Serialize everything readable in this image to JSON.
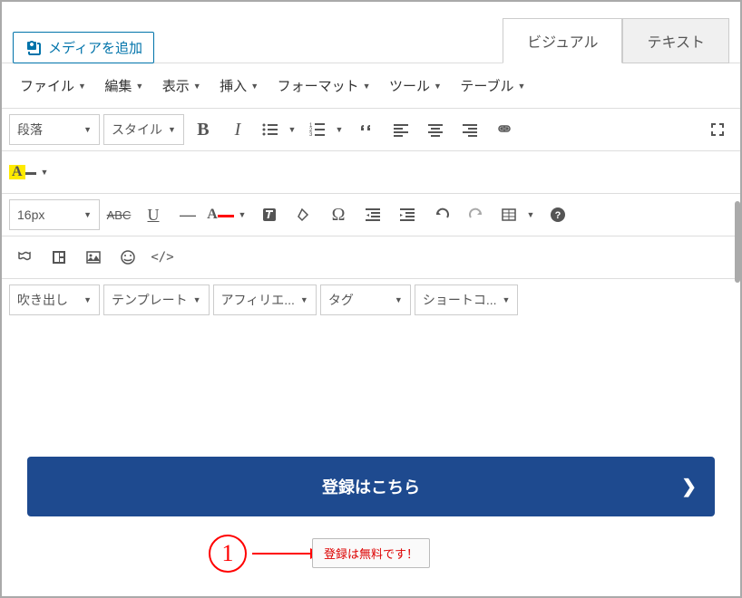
{
  "media_button": "メディアを追加",
  "tabs": {
    "visual": "ビジュアル",
    "text": "テキスト"
  },
  "menu": {
    "file": "ファイル",
    "edit": "編集",
    "view": "表示",
    "insert": "挿入",
    "format": "フォーマット",
    "tool": "ツール",
    "table": "テーブル"
  },
  "toolbar": {
    "paragraph": "段落",
    "style": "スタイル",
    "font_size": "16px",
    "balloon": "吹き出し",
    "template": "テンプレート",
    "affiliate": "アフィリエ...",
    "tag": "タグ",
    "shortcode": "ショートコ..."
  },
  "cta": {
    "label": "登録はこちら"
  },
  "annotation": {
    "number": "1",
    "tooltip": "登録は無料です！"
  }
}
